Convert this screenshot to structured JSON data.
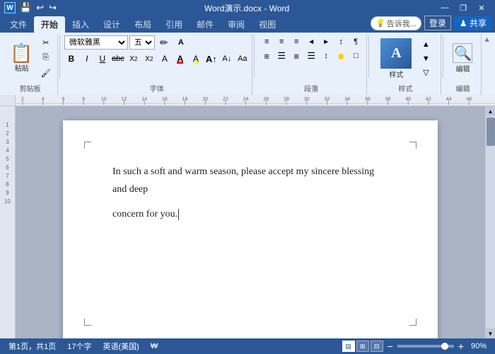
{
  "titlebar": {
    "title": "Word演示.docx - Word",
    "icon_label": "W",
    "quick_save": "💾",
    "quick_undo": "↩",
    "quick_redo": "↪",
    "minimize": "—",
    "restore": "❐",
    "close": "✕"
  },
  "menutabs": {
    "items": [
      "文件",
      "开始",
      "插入",
      "设计",
      "布局",
      "引用",
      "邮件",
      "审阅",
      "视图"
    ]
  },
  "active_tab": "开始",
  "ribbon": {
    "clipboard": {
      "label": "剪贴板",
      "paste": "粘贴",
      "cut": "✂",
      "copy": "⎘",
      "format_painter": "🖌"
    },
    "font": {
      "label": "字体",
      "name": "微软雅黑",
      "size": "五号",
      "bold": "B",
      "italic": "I",
      "underline": "U",
      "strikethrough": "abc",
      "subscript": "X₂",
      "superscript": "X²",
      "clear_format": "A",
      "font_color": "A",
      "highlight": "A",
      "grow": "A↑",
      "shrink": "A↓",
      "case": "Aa"
    },
    "paragraph": {
      "label": "段落",
      "bullets": "≡",
      "numbering": "≡",
      "multilevel": "≡",
      "decrease_indent": "←",
      "increase_indent": "→",
      "sort": "↕",
      "show_para": "¶",
      "align_left": "≡",
      "align_center": "≡",
      "align_right": "≡",
      "justify": "≡",
      "line_spacing": "↕",
      "shading": "■",
      "borders": "□"
    },
    "styles": {
      "label": "样式",
      "btn_label": "样式"
    },
    "editing": {
      "label": "编辑",
      "btn_label": "编辑"
    }
  },
  "tell_me": {
    "placeholder": "告诉我...",
    "icon": "💡"
  },
  "login": {
    "label": "登录"
  },
  "share": {
    "label": "♟ 共享"
  },
  "document": {
    "line1": "In such a soft and warm season, please accept my sincere blessing and deep",
    "line2": "concern for you."
  },
  "statusbar": {
    "page_info": "第1页，共1页",
    "word_count": "17个字",
    "language": "英语(美国)",
    "track": "₩",
    "zoom_percent": "90%",
    "zoom_minus": "−",
    "zoom_plus": "+"
  },
  "ruler": {
    "marks": [
      "2",
      "4",
      "6",
      "8",
      "10",
      "12",
      "14",
      "16",
      "18",
      "20",
      "22",
      "24",
      "26",
      "28",
      "30",
      "32",
      "34",
      "36",
      "38",
      "40",
      "42",
      "44",
      "46"
    ]
  }
}
